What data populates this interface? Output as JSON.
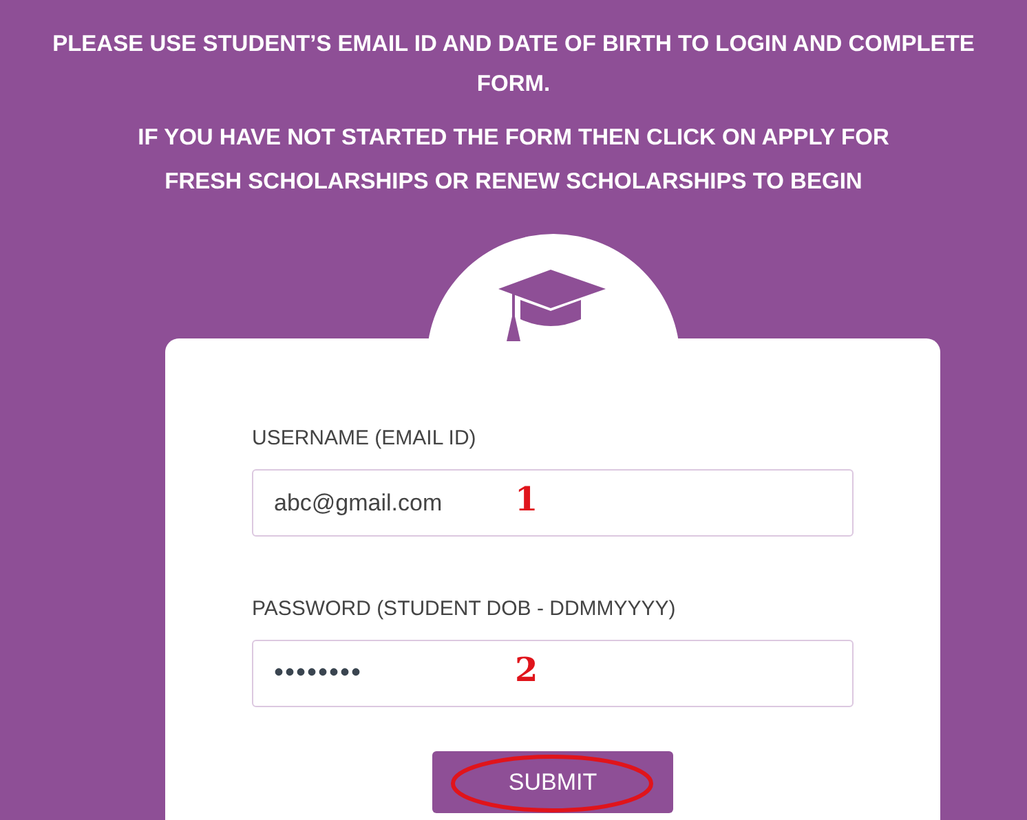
{
  "notice": {
    "lines": [
      "PLEASE USE STUDENT’S EMAIL ID AND DATE OF BIRTH TO LOGIN AND COMPLETE",
      "FORM."
    ],
    "hint": "IF YOU HAVE NOT STARTED THE FORM THEN CLICK ON APPLY FOR FRESH SCHOLARSHIPS OR RENEW SCHOLARSHIPS TO BEGIN"
  },
  "login": {
    "fields": [
      {
        "label": "USERNAME (EMAIL ID)",
        "value": "abc@gmail.com",
        "annotation": "1",
        "kind": "text"
      },
      {
        "label": "PASSWORD (STUDENT DOB - DDMMYYYY)",
        "value": "••••••••",
        "annotation": "2",
        "kind": "password"
      }
    ],
    "submit": {
      "label": "SUBMIT",
      "circled": true
    }
  }
}
